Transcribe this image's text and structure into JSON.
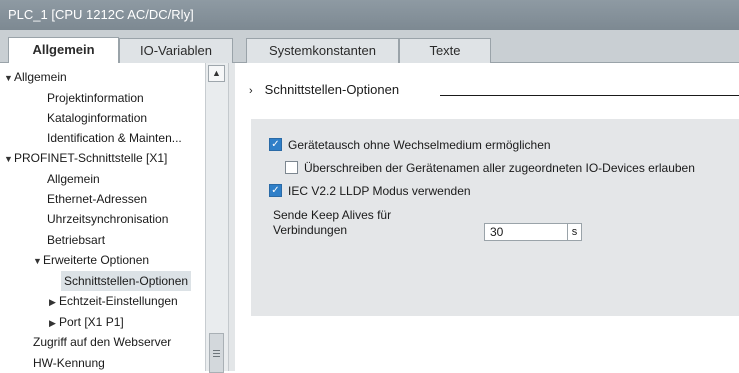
{
  "window": {
    "title": "PLC_1 [CPU 1212C AC/DC/Rly]"
  },
  "tabs": [
    {
      "label": "Allgemein",
      "active": true
    },
    {
      "label": "IO-Variablen",
      "active": false
    },
    {
      "label": "Systemkonstanten",
      "active": false
    },
    {
      "label": "Texte",
      "active": false
    }
  ],
  "tree": {
    "items": [
      {
        "label": "Allgemein",
        "expanded": true
      },
      {
        "label": "Projektinformation"
      },
      {
        "label": "Kataloginformation"
      },
      {
        "label": "Identification & Mainten..."
      },
      {
        "label": "PROFINET-Schnittstelle [X1]",
        "expanded": true
      },
      {
        "label": "Allgemein"
      },
      {
        "label": "Ethernet-Adressen"
      },
      {
        "label": "Uhrzeitsynchronisation"
      },
      {
        "label": "Betriebsart"
      },
      {
        "label": "Erweiterte Optionen",
        "expanded": true
      },
      {
        "label": "Schnittstellen-Optionen",
        "selected": true
      },
      {
        "label": "Echtzeit-Einstellungen",
        "expanded": false
      },
      {
        "label": "Port [X1 P1]",
        "expanded": false
      },
      {
        "label": "Zugriff auf den Webserver"
      },
      {
        "label": "HW-Kennung"
      }
    ]
  },
  "section": {
    "title": "Schnittstellen-Optionen"
  },
  "options": {
    "device_replacement": {
      "label": "Gerätetausch ohne Wechselmedium ermöglichen",
      "checked": true
    },
    "overwrite_names": {
      "label": "Überschreiben der Gerätenamen aller zugeordneten IO-Devices erlauben",
      "checked": false
    },
    "lldp_mode": {
      "label": "IEC V2.2 LLDP Modus verwenden",
      "checked": true
    }
  },
  "keep_alive": {
    "label_line1": "Sende Keep Alives für",
    "label_line2": "Verbindungen",
    "value": "30",
    "unit": "s"
  },
  "colors": {
    "titlebar": "#8e9aa3",
    "tabbar": "#c9cfd3",
    "panel": "#e4e6e8",
    "checkbox_checked": "#2f7fc8",
    "selected_item": "#dce2e6"
  }
}
